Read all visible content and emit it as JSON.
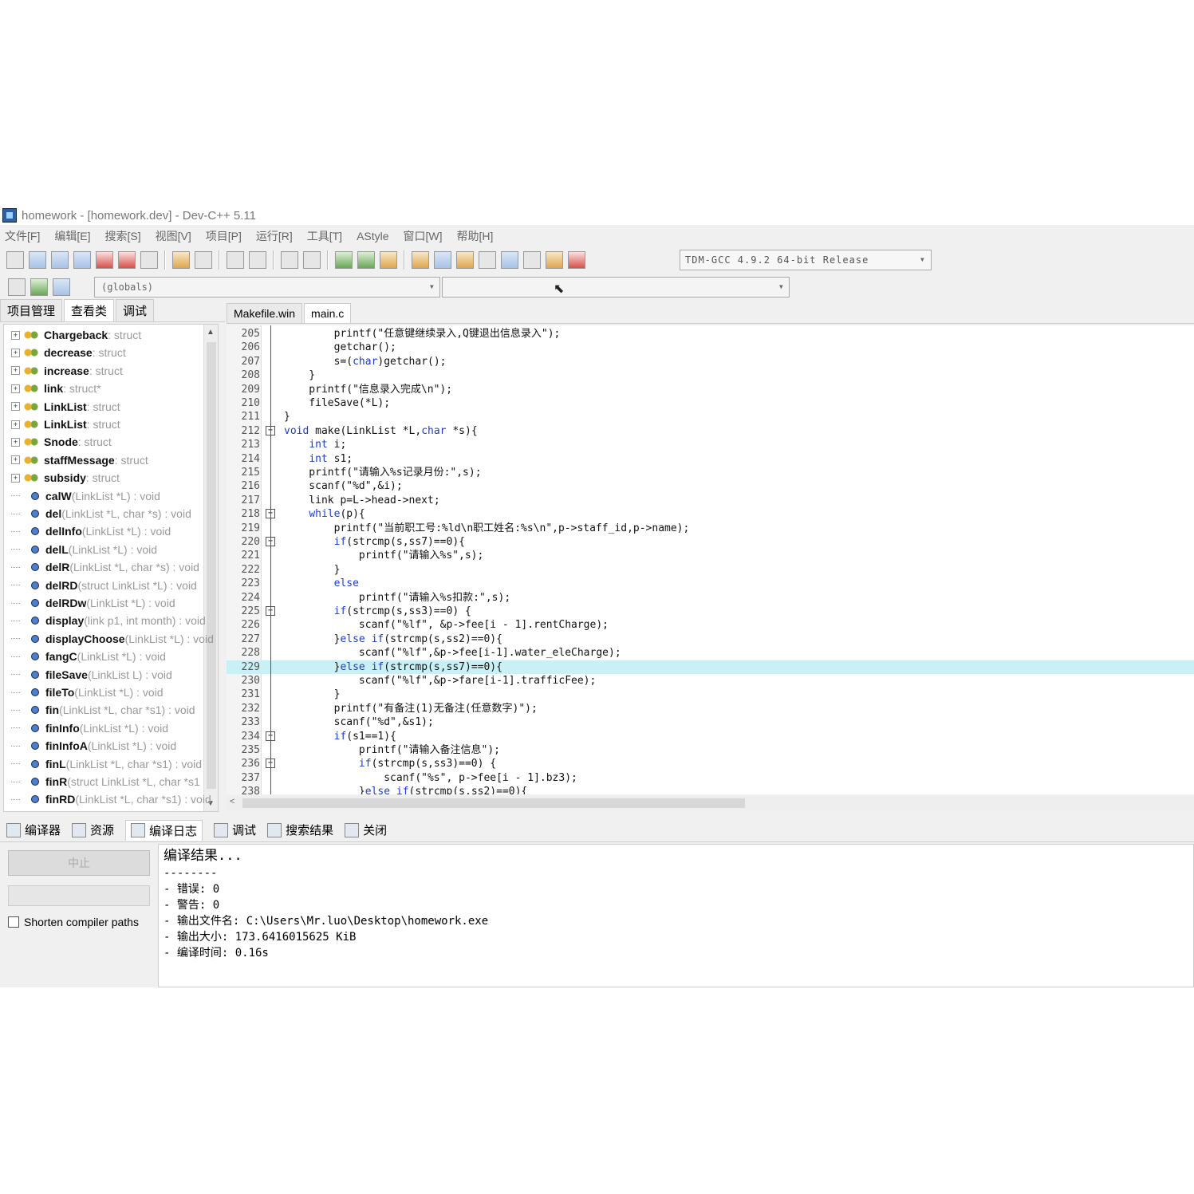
{
  "window": {
    "title": "homework - [homework.dev] - Dev-C++ 5.11"
  },
  "menu": [
    "文件[F]",
    "编辑[E]",
    "搜索[S]",
    "视图[V]",
    "项目[P]",
    "运行[R]",
    "工具[T]",
    "AStyle",
    "窗口[W]",
    "帮助[H]"
  ],
  "toolbar": {
    "compiler": "TDM-GCC 4.9.2 64-bit Release",
    "scope_combo": "(globals)",
    "member_combo": ""
  },
  "left_panel": {
    "tabs": [
      "项目管理",
      "查看类",
      "调试"
    ],
    "active_tab": "查看类",
    "tree": [
      {
        "name": "Chargeback",
        "type": " : struct",
        "kind": "struct"
      },
      {
        "name": "decrease",
        "type": " : struct",
        "kind": "struct"
      },
      {
        "name": "increase",
        "type": " : struct",
        "kind": "struct"
      },
      {
        "name": "link",
        "type": " : struct*",
        "kind": "struct"
      },
      {
        "name": "LinkList",
        "type": " : struct",
        "kind": "struct"
      },
      {
        "name": "LinkList",
        "type": " : struct",
        "kind": "struct"
      },
      {
        "name": "Snode",
        "type": " : struct",
        "kind": "struct"
      },
      {
        "name": "staffMessage",
        "type": " : struct",
        "kind": "struct"
      },
      {
        "name": "subsidy",
        "type": " : struct",
        "kind": "struct"
      },
      {
        "name": "calW",
        "type": " (LinkList *L) : void",
        "kind": "func"
      },
      {
        "name": "del",
        "type": " (LinkList *L, char *s) : void",
        "kind": "func"
      },
      {
        "name": "delInfo",
        "type": " (LinkList *L) : void",
        "kind": "func"
      },
      {
        "name": "delL",
        "type": " (LinkList *L) : void",
        "kind": "func"
      },
      {
        "name": "delR",
        "type": " (LinkList *L, char *s) : void",
        "kind": "func"
      },
      {
        "name": "delRD",
        "type": " (struct LinkList *L) : void",
        "kind": "func"
      },
      {
        "name": "delRDw",
        "type": " (LinkList *L) : void",
        "kind": "func"
      },
      {
        "name": "display",
        "type": " (link p1, int month) : void",
        "kind": "func"
      },
      {
        "name": "displayChoose",
        "type": " (LinkList *L) : void",
        "kind": "func"
      },
      {
        "name": "fangC",
        "type": " (LinkList *L) : void",
        "kind": "func"
      },
      {
        "name": "fileSave",
        "type": " (LinkList L) : void",
        "kind": "func"
      },
      {
        "name": "fileTo",
        "type": " (LinkList *L) : void",
        "kind": "func"
      },
      {
        "name": "fin",
        "type": " (LinkList *L, char *s1) : void",
        "kind": "func"
      },
      {
        "name": "finInfo",
        "type": " (LinkList *L) : void",
        "kind": "func"
      },
      {
        "name": "finInfoA",
        "type": " (LinkList *L) : void",
        "kind": "func"
      },
      {
        "name": "finL",
        "type": " (LinkList *L, char *s1) : void",
        "kind": "func"
      },
      {
        "name": "finR",
        "type": " (struct LinkList *L, char *s1",
        "kind": "func"
      },
      {
        "name": "finRD",
        "type": " (LinkList *L, char *s1) : void",
        "kind": "func"
      }
    ]
  },
  "editor": {
    "tabs": [
      "Makefile.win",
      "main.c"
    ],
    "active_tab": "main.c",
    "lines": [
      {
        "n": "205",
        "code": "        printf(\"任意键继续录入,Q键退出信息录入\");"
      },
      {
        "n": "206",
        "code": "        getchar();"
      },
      {
        "n": "207",
        "code": "        s=(char)getchar();"
      },
      {
        "n": "208",
        "code": "    }"
      },
      {
        "n": "209",
        "code": "    printf(\"信息录入完成\\n\");"
      },
      {
        "n": "210",
        "code": "    fileSave(*L);"
      },
      {
        "n": "211",
        "code": "}"
      },
      {
        "n": "212",
        "code": "void make(LinkList *L,char *s){"
      },
      {
        "n": "213",
        "code": "    int i;"
      },
      {
        "n": "214",
        "code": "    int s1;"
      },
      {
        "n": "215",
        "code": "    printf(\"请输入%s记录月份:\",s);"
      },
      {
        "n": "216",
        "code": "    scanf(\"%d\",&i);"
      },
      {
        "n": "217",
        "code": "    link p=L->head->next;"
      },
      {
        "n": "218",
        "code": "    while(p){"
      },
      {
        "n": "219",
        "code": "        printf(\"当前职工号:%ld\\n职工姓名:%s\\n\",p->staff_id,p->name);"
      },
      {
        "n": "220",
        "code": "        if(strcmp(s,ss7)==0){"
      },
      {
        "n": "221",
        "code": "            printf(\"请输入%s\",s);"
      },
      {
        "n": "222",
        "code": "        }"
      },
      {
        "n": "223",
        "code": "        else"
      },
      {
        "n": "224",
        "code": "            printf(\"请输入%s扣款:\",s);"
      },
      {
        "n": "225",
        "code": "        if(strcmp(s,ss3)==0) {"
      },
      {
        "n": "226",
        "code": "            scanf(\"%lf\", &p->fee[i - 1].rentCharge);"
      },
      {
        "n": "227",
        "code": "        }else if(strcmp(s,ss2)==0){"
      },
      {
        "n": "228",
        "code": "            scanf(\"%lf\",&p->fee[i-1].water_eleCharge);"
      },
      {
        "n": "229",
        "code": "        }else if(strcmp(s,ss7)==0){"
      },
      {
        "n": "230",
        "code": "            scanf(\"%lf\",&p->fare[i-1].trafficFee);"
      },
      {
        "n": "231",
        "code": "        }"
      },
      {
        "n": "232",
        "code": "        printf(\"有备注(1)无备注(任意数字)\");"
      },
      {
        "n": "233",
        "code": "        scanf(\"%d\",&s1);"
      },
      {
        "n": "234",
        "code": "        if(s1==1){"
      },
      {
        "n": "235",
        "code": "            printf(\"请输入备注信息\");"
      },
      {
        "n": "236",
        "code": "            if(strcmp(s,ss3)==0) {"
      },
      {
        "n": "237",
        "code": "                scanf(\"%s\", p->fee[i - 1].bz3);"
      },
      {
        "n": "238",
        "code": "            }else if(strcmp(s,ss2)==0){"
      }
    ]
  },
  "bottom_panel": {
    "tabs": [
      "编译器",
      "资源",
      "编译日志",
      "调试",
      "搜索结果",
      "关闭"
    ],
    "active_tab": "编译日志",
    "abort_label": "中止",
    "shorten_label": "Shorten compiler paths",
    "log": [
      "编译结果...",
      "--------",
      "- 错误: 0",
      "- 警告: 0",
      "- 输出文件名: C:\\Users\\Mr.luo\\Desktop\\homework.exe",
      "- 输出大小: 173.6416015625 KiB",
      "- 编译时间: 0.16s"
    ]
  }
}
